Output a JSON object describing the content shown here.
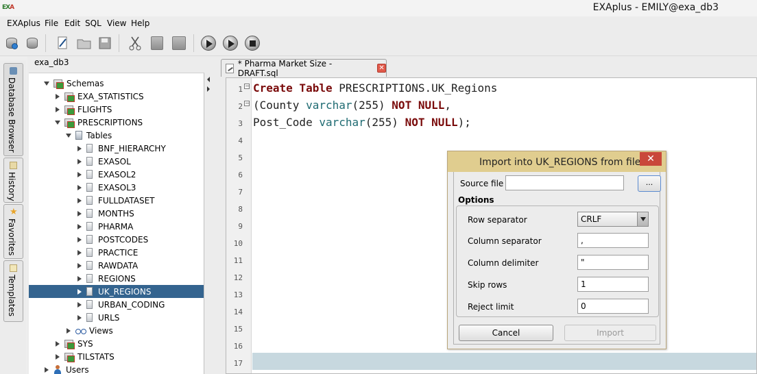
{
  "window": {
    "title": "EXAplus - EMILY@exa_db3",
    "logo_text_1": "EX",
    "logo_text_2": "A"
  },
  "menu": [
    {
      "label": "EXAplus"
    },
    {
      "label": "File"
    },
    {
      "label": "Edit"
    },
    {
      "label": "SQL"
    },
    {
      "label": "View"
    },
    {
      "label": "Help"
    }
  ],
  "toolbar": {
    "icons": [
      "connect-icon",
      "disconnect-icon",
      "new-file-icon",
      "open-folder-icon",
      "save-icon",
      "cut-icon",
      "copy-icon",
      "paste-icon",
      "execute-icon",
      "execute-current-icon",
      "stop-icon"
    ]
  },
  "left_tabs": [
    {
      "label": "Database Browser"
    },
    {
      "label": "History"
    },
    {
      "label": "Favorites"
    },
    {
      "label": "Templates"
    }
  ],
  "db_browser": {
    "connection": "exa_db3",
    "tree": [
      {
        "label": "Schemas",
        "level": 1,
        "kind": "schemas",
        "expanded": true
      },
      {
        "label": "EXA_STATISTICS",
        "level": 2,
        "kind": "schema",
        "expanded": false
      },
      {
        "label": "FLIGHTS",
        "level": 2,
        "kind": "schema",
        "expanded": false
      },
      {
        "label": "PRESCRIPTIONS",
        "level": 2,
        "kind": "schema",
        "expanded": true
      },
      {
        "label": "Tables",
        "level": 3,
        "kind": "folder",
        "expanded": true
      },
      {
        "label": "BNF_HIERARCHY",
        "level": 4,
        "kind": "table",
        "expanded": false
      },
      {
        "label": "EXASOL",
        "level": 4,
        "kind": "table",
        "expanded": false
      },
      {
        "label": "EXASOL2",
        "level": 4,
        "kind": "table",
        "expanded": false
      },
      {
        "label": "EXASOL3",
        "level": 4,
        "kind": "table",
        "expanded": false
      },
      {
        "label": "FULLDATASET",
        "level": 4,
        "kind": "table",
        "expanded": false
      },
      {
        "label": "MONTHS",
        "level": 4,
        "kind": "table",
        "expanded": false
      },
      {
        "label": "PHARMA",
        "level": 4,
        "kind": "table",
        "expanded": false
      },
      {
        "label": "POSTCODES",
        "level": 4,
        "kind": "table",
        "expanded": false
      },
      {
        "label": "PRACTICE",
        "level": 4,
        "kind": "table",
        "expanded": false
      },
      {
        "label": "RAWDATA",
        "level": 4,
        "kind": "table",
        "expanded": false
      },
      {
        "label": "REGIONS",
        "level": 4,
        "kind": "table",
        "expanded": false
      },
      {
        "label": "UK_REGIONS",
        "level": 4,
        "kind": "table",
        "expanded": false,
        "selected": true
      },
      {
        "label": "URBAN_CODING",
        "level": 4,
        "kind": "table",
        "expanded": false
      },
      {
        "label": "URLS",
        "level": 4,
        "kind": "table",
        "expanded": false
      },
      {
        "label": "Views",
        "level": 3,
        "kind": "views",
        "expanded": false
      },
      {
        "label": "SYS",
        "level": 2,
        "kind": "schema",
        "expanded": false
      },
      {
        "label": "TILSTATS",
        "level": 2,
        "kind": "schema",
        "expanded": false
      },
      {
        "label": "Users",
        "level": 1,
        "kind": "users",
        "expanded": false
      }
    ]
  },
  "editor": {
    "tab_label": "* Pharma Market Size - DRAFT.sql",
    "tab_close": "✕",
    "line_numbers": [
      "1",
      "2",
      "3",
      "4",
      "5",
      "6",
      "7",
      "8",
      "9",
      "10",
      "11",
      "12",
      "13",
      "14",
      "15",
      "16",
      "17"
    ],
    "lines": [
      [
        {
          "t": "Create Table",
          "c": "kw"
        },
        {
          "t": " PRESCRIPTIONS.UK_Regions",
          "c": ""
        }
      ],
      [
        {
          "t": "(County ",
          "c": ""
        },
        {
          "t": "varchar",
          "c": "ty"
        },
        {
          "t": "(255) ",
          "c": ""
        },
        {
          "t": "NOT NULL",
          "c": "kw"
        },
        {
          "t": ",",
          "c": ""
        }
      ],
      [
        {
          "t": "Post_Code ",
          "c": ""
        },
        {
          "t": "varchar",
          "c": "ty"
        },
        {
          "t": "(255) ",
          "c": ""
        },
        {
          "t": "NOT NULL",
          "c": "kw"
        },
        {
          "t": ");",
          "c": ""
        }
      ]
    ]
  },
  "import_dialog": {
    "title": "Import into UK_REGIONS from file",
    "close": "✕",
    "source_file_label": "Source file",
    "source_file_value": "",
    "browse_label": "...",
    "options_label": "Options",
    "row_separator_label": "Row separator",
    "row_separator_value": "CRLF",
    "column_separator_label": "Column separator",
    "column_separator_value": ",",
    "column_delimiter_label": "Column delimiter",
    "column_delimiter_value": "\"",
    "skip_rows_label": "Skip rows",
    "skip_rows_value": "1",
    "reject_limit_label": "Reject limit",
    "reject_limit_value": "0",
    "cancel_label": "Cancel",
    "import_label": "Import"
  }
}
